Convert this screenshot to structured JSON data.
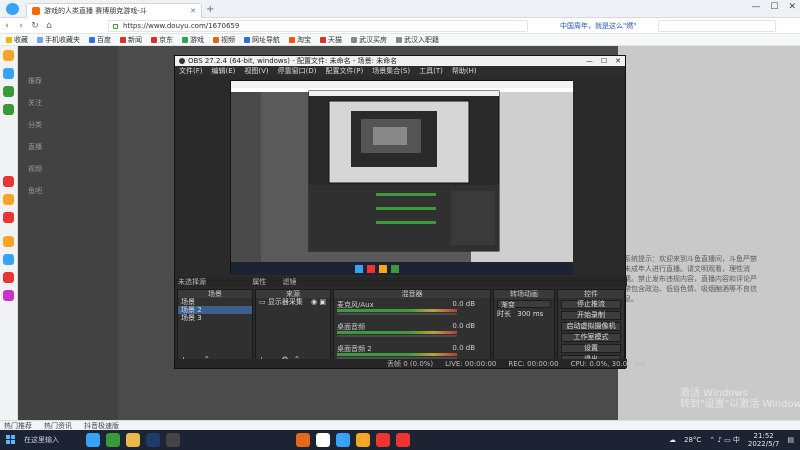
{
  "browser": {
    "tab_title": "游戏的人类直播 赛博朋克游戏-斗",
    "url": "https://www.douyu.com/1670659",
    "news_ticker": "中国周年，就是这么\"燃\"",
    "search_placeholder": "",
    "bookmarks": [
      "收藏",
      "手机收藏夹",
      "百度",
      "新闻",
      "京东",
      "游戏",
      "视频",
      "网址导航",
      "淘宝",
      "天猫",
      "武汉买房",
      "武汉入职籍"
    ]
  },
  "obs": {
    "title": "OBS 27.2.4 (64-bit, windows) - 配置文件: 未命名 - 场景: 未命名",
    "menu": [
      "文件(F)",
      "编辑(E)",
      "视图(V)",
      "停靠窗口(D)",
      "配置文件(P)",
      "场景集合(S)",
      "工具(T)",
      "帮助(H)"
    ],
    "no_source": "未选择源",
    "props_btn": "属性",
    "filters_btn": "滤镜",
    "scenes_title": "场景",
    "scenes": [
      "场景",
      "场景 2",
      "场景 3"
    ],
    "sources_title": "来源",
    "sources": [
      "显示器采集"
    ],
    "mixer_title": "混音器",
    "mixer_tracks": [
      {
        "name": "麦克风/Aux",
        "value": "0.0 dB"
      },
      {
        "name": "桌面音频",
        "value": "0.0 dB"
      },
      {
        "name": "桌面音频 2",
        "value": "0.0 dB"
      }
    ],
    "transitions_title": "转场动画",
    "transition_value": "渐变",
    "duration_label": "时长",
    "duration_value": "300 ms",
    "controls_title": "控件",
    "controls": [
      "停止推流",
      "开始录制",
      "启动虚拟摄像机",
      "工作室模式",
      "设置",
      "退出"
    ],
    "status": [
      "丢帧 0 (0.0%)",
      "LIVE: 00:00:00",
      "REC: 00:00:00",
      "CPU: 0.0%, 30.00 fps"
    ]
  },
  "page": {
    "sidebar_items": [
      "推荐",
      "关注",
      "分类",
      "直播",
      "视频",
      "鱼吧"
    ],
    "chat_text": "系统提示：欢迎来到斗鱼直播间，斗鱼严禁未成年人进行直播。请文明观看，理性消费。禁止发布违规内容，直播内容和评论严禁包含政治、低俗色情、吸烟酗酒等不良信息。"
  },
  "statusbar": {
    "items": [
      "热门推荐",
      "热门资讯",
      "抖音极速版"
    ]
  },
  "watermark": {
    "line1": "激活 Windows",
    "line2": "转到\"设置\"以激活 Windows。"
  },
  "taskbar": {
    "search_text": "在这里输入",
    "temperature": "28°C",
    "time": "21:52",
    "date": "2022/5/7"
  }
}
